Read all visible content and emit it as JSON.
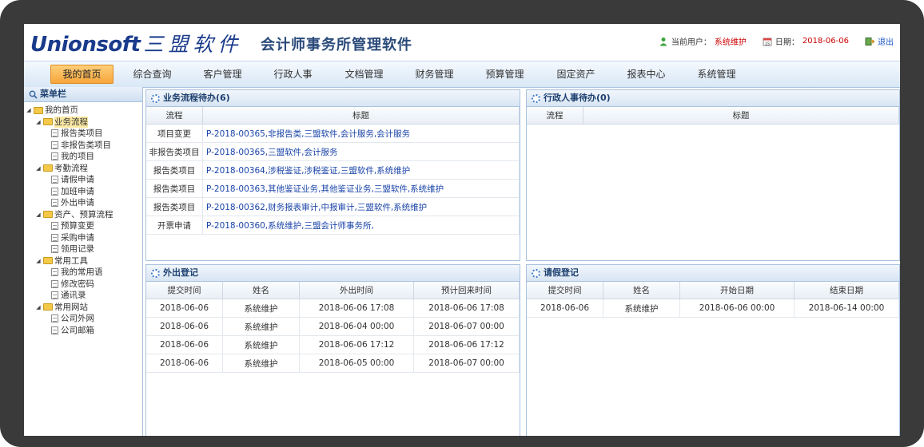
{
  "header": {
    "logo_en": "Unionsoft",
    "logo_cn": "三盟软件",
    "app_title": "会计师事务所管理软件",
    "user_label": "当前用户：",
    "user_value": "系统维护",
    "date_label": "日期：",
    "date_value": "2018-06-06",
    "logout": "退出"
  },
  "nav": [
    "我的首页",
    "综合查询",
    "客户管理",
    "行政人事",
    "文档管理",
    "财务管理",
    "预算管理",
    "固定资产",
    "报表中心",
    "系统管理"
  ],
  "sidebar": {
    "title": "菜单栏",
    "tree": [
      {
        "label": "我的首页",
        "type": "folder",
        "level": 0,
        "open": true
      },
      {
        "label": "业务流程",
        "type": "folder",
        "level": 1,
        "open": true,
        "selected": true
      },
      {
        "label": "报告类项目",
        "type": "doc",
        "level": 2
      },
      {
        "label": "非报告类项目",
        "type": "doc",
        "level": 2
      },
      {
        "label": "我的项目",
        "type": "doc",
        "level": 2
      },
      {
        "label": "考勤流程",
        "type": "folder",
        "level": 1,
        "open": true
      },
      {
        "label": "请假申请",
        "type": "doc",
        "level": 2
      },
      {
        "label": "加班申请",
        "type": "doc",
        "level": 2
      },
      {
        "label": "外出申请",
        "type": "doc",
        "level": 2
      },
      {
        "label": "资产、预算流程",
        "type": "folder",
        "level": 1,
        "open": true
      },
      {
        "label": "预算变更",
        "type": "doc",
        "level": 2
      },
      {
        "label": "采购申请",
        "type": "doc",
        "level": 2
      },
      {
        "label": "领用记录",
        "type": "doc",
        "level": 2
      },
      {
        "label": "常用工具",
        "type": "folder",
        "level": 1,
        "open": true
      },
      {
        "label": "我的常用语",
        "type": "doc",
        "level": 2
      },
      {
        "label": "修改密码",
        "type": "doc",
        "level": 2
      },
      {
        "label": "通讯录",
        "type": "doc",
        "level": 2
      },
      {
        "label": "常用网站",
        "type": "folder",
        "level": 1,
        "open": true
      },
      {
        "label": "公司外网",
        "type": "doc",
        "level": 2
      },
      {
        "label": "公司邮箱",
        "type": "doc",
        "level": 2
      }
    ]
  },
  "workflow_panel": {
    "title": "业务流程待办(6)",
    "columns": [
      "流程",
      "标题"
    ],
    "rows": [
      [
        "项目变更",
        "P-2018-00365,非报告类,三盟软件,会计服务,会计服务"
      ],
      [
        "非报告类项目",
        "P-2018-00365,三盟软件,会计服务"
      ],
      [
        "报告类项目",
        "P-2018-00364,涉税鉴证,涉税鉴证,三盟软件,系统维护"
      ],
      [
        "报告类项目",
        "P-2018-00363,其他鉴证业务,其他鉴证业务,三盟软件,系统维护"
      ],
      [
        "报告类项目",
        "P-2018-00362,财务报表审计,中报审计,三盟软件,系统维护"
      ],
      [
        "开票申请",
        "P-2018-00360,系统维护,三盟会计师事务所,"
      ]
    ]
  },
  "hr_panel": {
    "title": "行政人事待办(0)",
    "columns": [
      "流程",
      "标题"
    ],
    "rows": []
  },
  "outing_panel": {
    "title": "外出登记",
    "columns": [
      "提交时间",
      "姓名",
      "外出时间",
      "预计回来时间"
    ],
    "rows": [
      [
        "2018-06-06",
        "系统维护",
        "2018-06-06 17:08",
        "2018-06-06 17:08"
      ],
      [
        "2018-06-06",
        "系统维护",
        "2018-06-04 00:00",
        "2018-06-07 00:00"
      ],
      [
        "2018-06-06",
        "系统维护",
        "2018-06-06 17:12",
        "2018-06-06 17:12"
      ],
      [
        "2018-06-06",
        "系统维护",
        "2018-06-05 00:00",
        "2018-06-07 00:00"
      ]
    ]
  },
  "leave_panel": {
    "title": "请假登记",
    "columns": [
      "提交时间",
      "姓名",
      "开始日期",
      "结束日期"
    ],
    "rows": [
      [
        "2018-06-06",
        "系统维护",
        "2018-06-06 00:00",
        "2018-06-14 00:00"
      ]
    ]
  }
}
